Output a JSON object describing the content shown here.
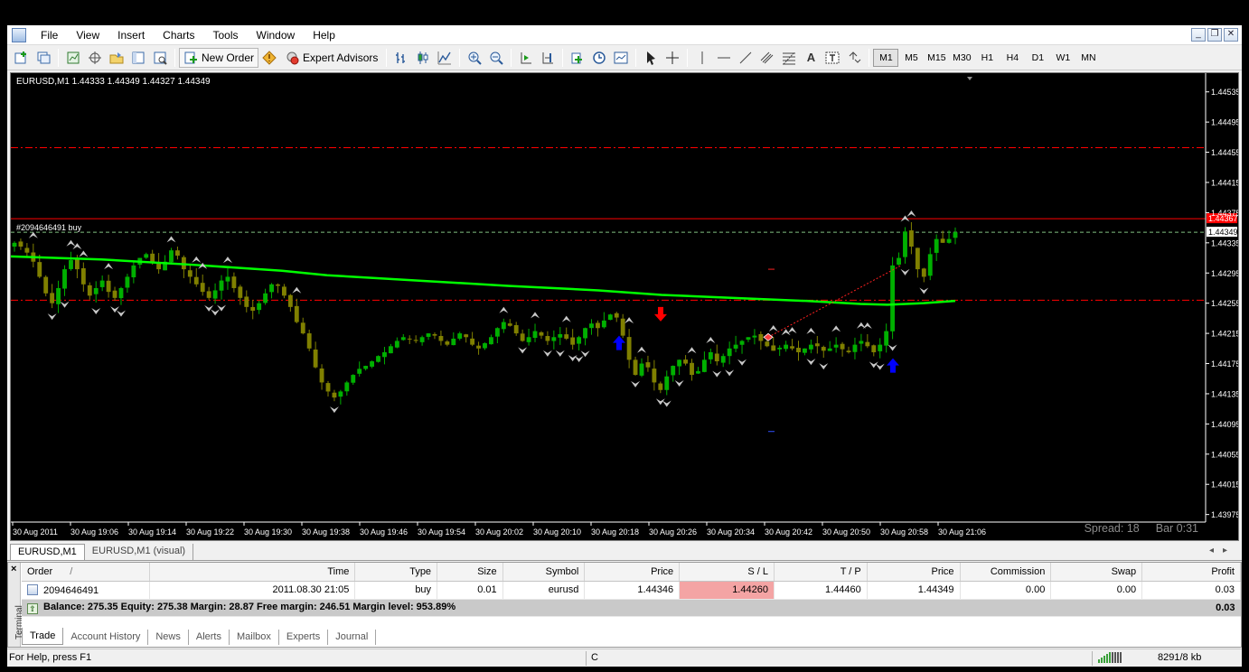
{
  "menu": [
    "File",
    "View",
    "Insert",
    "Charts",
    "Tools",
    "Window",
    "Help"
  ],
  "toolbar": {
    "new_order": "New Order",
    "expert_advisors": "Expert Advisors",
    "timeframes": [
      "M1",
      "M5",
      "M15",
      "M30",
      "H1",
      "H4",
      "D1",
      "W1",
      "MN"
    ],
    "active_timeframe": "M1"
  },
  "chart": {
    "title": "EURUSD,M1  1.44333 1.44349 1.44327 1.44349",
    "order_label": "#2094646491 buy",
    "spread_text": "Spread: 18",
    "bar_text": "Bar  0:31",
    "price_ticks": [
      "1.44535",
      "1.44495",
      "1.44455",
      "1.44415",
      "1.44375",
      "1.44335",
      "1.44295",
      "1.44255",
      "1.44215",
      "1.44175",
      "1.44135",
      "1.44095",
      "1.44055",
      "1.44015",
      "1.43975"
    ],
    "time_ticks": [
      "30 Aug 2011",
      "30 Aug 19:06",
      "30 Aug 19:14",
      "30 Aug 19:22",
      "30 Aug 19:30",
      "30 Aug 19:38",
      "30 Aug 19:46",
      "30 Aug 19:54",
      "30 Aug 20:02",
      "30 Aug 20:10",
      "30 Aug 20:18",
      "30 Aug 20:26",
      "30 Aug 20:34",
      "30 Aug 20:42",
      "30 Aug 20:50",
      "30 Aug 20:58",
      "30 Aug 21:06"
    ],
    "bid_label": "1.44349",
    "tp_label": "1.44367",
    "colors": {
      "bull": "#00b000",
      "bear": "#808000",
      "ma": "#00ff00",
      "tp_line": "#ff0000",
      "level_lines": "#ff0000",
      "buy_arrow": "#0000ff",
      "sell_arrow": "#ff0000"
    }
  },
  "chart_data": {
    "type": "candlestick",
    "symbol": "EURUSD",
    "timeframe": "M1",
    "ylim": [
      1.43965,
      1.44555
    ],
    "levels": {
      "tp": 1.44367,
      "bid": 1.44349,
      "upper_dashed": 1.44461,
      "lower_dashed": 1.44259
    }
  },
  "tabs": {
    "chart_tabs": [
      "EURUSD,M1",
      "EURUSD,M1 (visual)"
    ],
    "terminal_tabs": [
      "Trade",
      "Account History",
      "News",
      "Alerts",
      "Mailbox",
      "Experts",
      "Journal"
    ]
  },
  "terminal": {
    "side_label": "Terminal",
    "headers": [
      "Order",
      "/",
      "Time",
      "Type",
      "Size",
      "Symbol",
      "Price",
      "S / L",
      "T / P",
      "Price",
      "Commission",
      "Swap",
      "Profit"
    ],
    "row": {
      "order": "2094646491",
      "time": "2011.08.30 21:05",
      "type": "buy",
      "size": "0.01",
      "symbol": "eurusd",
      "price": "1.44346",
      "sl": "1.44260",
      "tp": "1.44460",
      "cur_price": "1.44349",
      "commission": "0.00",
      "swap": "0.00",
      "profit": "0.03"
    },
    "balance_text": "Balance: 275.35  Equity: 275.38  Margin: 28.87  Free margin: 246.51  Margin level: 953.89%",
    "balance_profit": "0.03"
  },
  "status": {
    "help": "For Help, press F1",
    "connection": "C",
    "traffic": "8291/8 kb"
  }
}
